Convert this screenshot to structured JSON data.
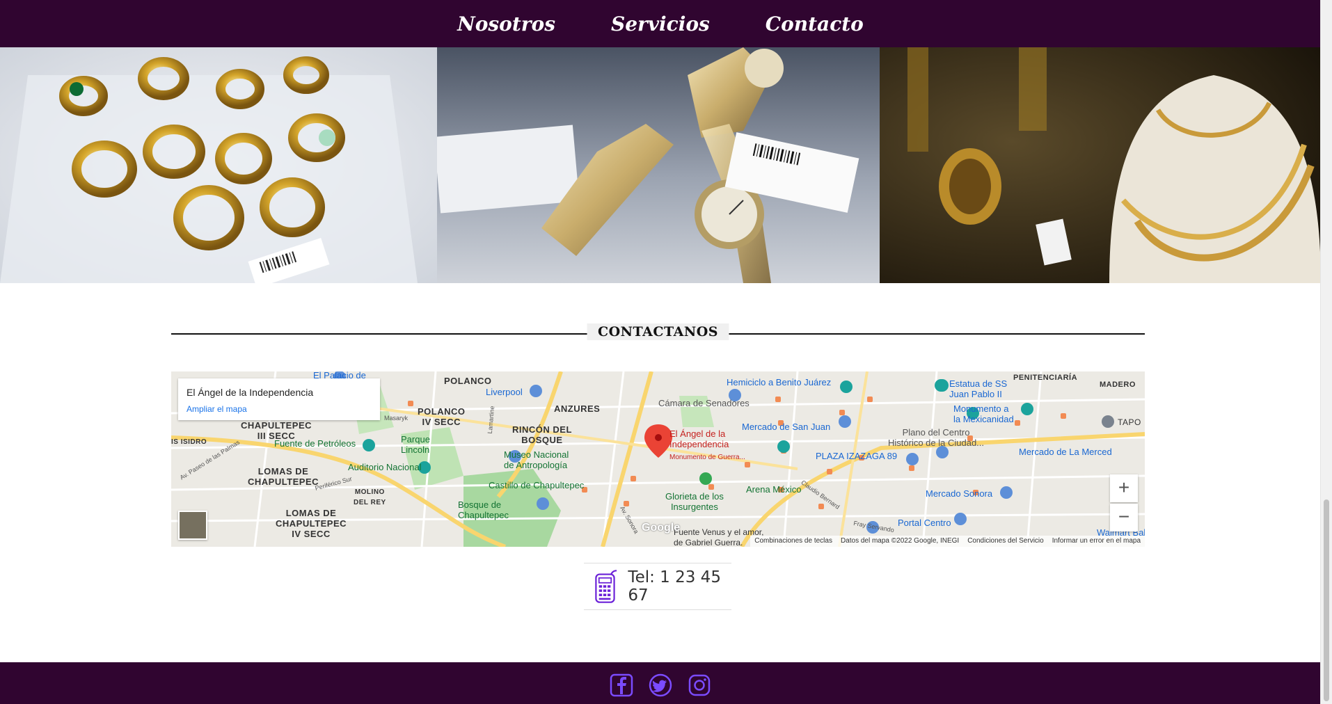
{
  "nav": {
    "items": [
      {
        "label": "Nosotros"
      },
      {
        "label": "Servicios"
      },
      {
        "label": "Contacto"
      }
    ]
  },
  "section": {
    "title": "CONTACTANOS"
  },
  "map": {
    "infobox": {
      "title": "El Ángel de la Independencia",
      "link": "Ampliar el mapa"
    },
    "labels": {
      "polanco": "POLANCO",
      "polanco4": "POLANCO\nIV SECC",
      "anzures": "ANZURES",
      "rincon": "RINCÓN DEL\nBOSQUE",
      "chapultepec3": "CHAPULTEPEC\nIII SECC",
      "lomas": "LOMAS DE\nCHAPULTEPEC",
      "lomas4": "LOMAS DE\nCHAPULTEPEC\nIV SECC",
      "molino": "MOLINO\nDEL REY",
      "isidro": "IS ISIDRO",
      "penitenciaria": "PENITENCIARÍA",
      "madero": "MADERO",
      "tapo": "TAPO",
      "palacio": "El Palacio de",
      "liverpool": "Liverpool",
      "camara": "Cámara de Senadores",
      "hemiciclo": "Hemiciclo a Benito Juárez",
      "estatua": "Estatua de SS\nJuan Pablo II",
      "monumento": "Monumento a\nla Mexicanidad",
      "mercado_sj": "Mercado de San Juan",
      "plano": "Plano del Centro\nHistórico de la Ciudad...",
      "fuente": "Fuente de Petróleos",
      "parque": "Parque\nLincoln",
      "museo": "Museo Nacional\nde Antropología",
      "auditorio": "Auditorio Nacional",
      "castillo": "Castillo de Chapultepec",
      "bosque": "Bosque de\nChapultepec",
      "angel": "El Ángel de la\nIndependencia",
      "angel_sub": "Monumento de Guerra...",
      "glorieta": "Glorieta de los\nInsurgentes",
      "arena": "Arena México",
      "plaza": "PLAZA IZAZAGA 89",
      "merced": "Mercado de La Merced",
      "sonora": "Mercado Sonora",
      "portal": "Portal Centro",
      "walmart": "Walmart Balbuer",
      "venus": "Fuente Venus y el amor,\nde Gabriel Guerra.",
      "masaryk": "Masaryk",
      "lamartine": "Lamartine",
      "palmas": "Av. Paseo de las Palmas",
      "periferico": "Periférico Sur",
      "av_sonora": "Av. Sonora",
      "bernard": "Claudio Bernard",
      "fray": "Fray Servando",
      "google": "Google"
    },
    "zoom_in": "+",
    "zoom_out": "−",
    "attribution": [
      "Combinaciones de teclas",
      "Datos del mapa ©2022 Google, INEGI",
      "Condiciones del Servicio",
      "Informar un error en el mapa"
    ]
  },
  "contact": {
    "phone": "Tel: 1 23 45 67"
  },
  "social": [
    "facebook-icon",
    "twitter-icon",
    "instagram-icon"
  ],
  "colors": {
    "brand": "#300530",
    "icon_purple": "#6b21d8"
  }
}
